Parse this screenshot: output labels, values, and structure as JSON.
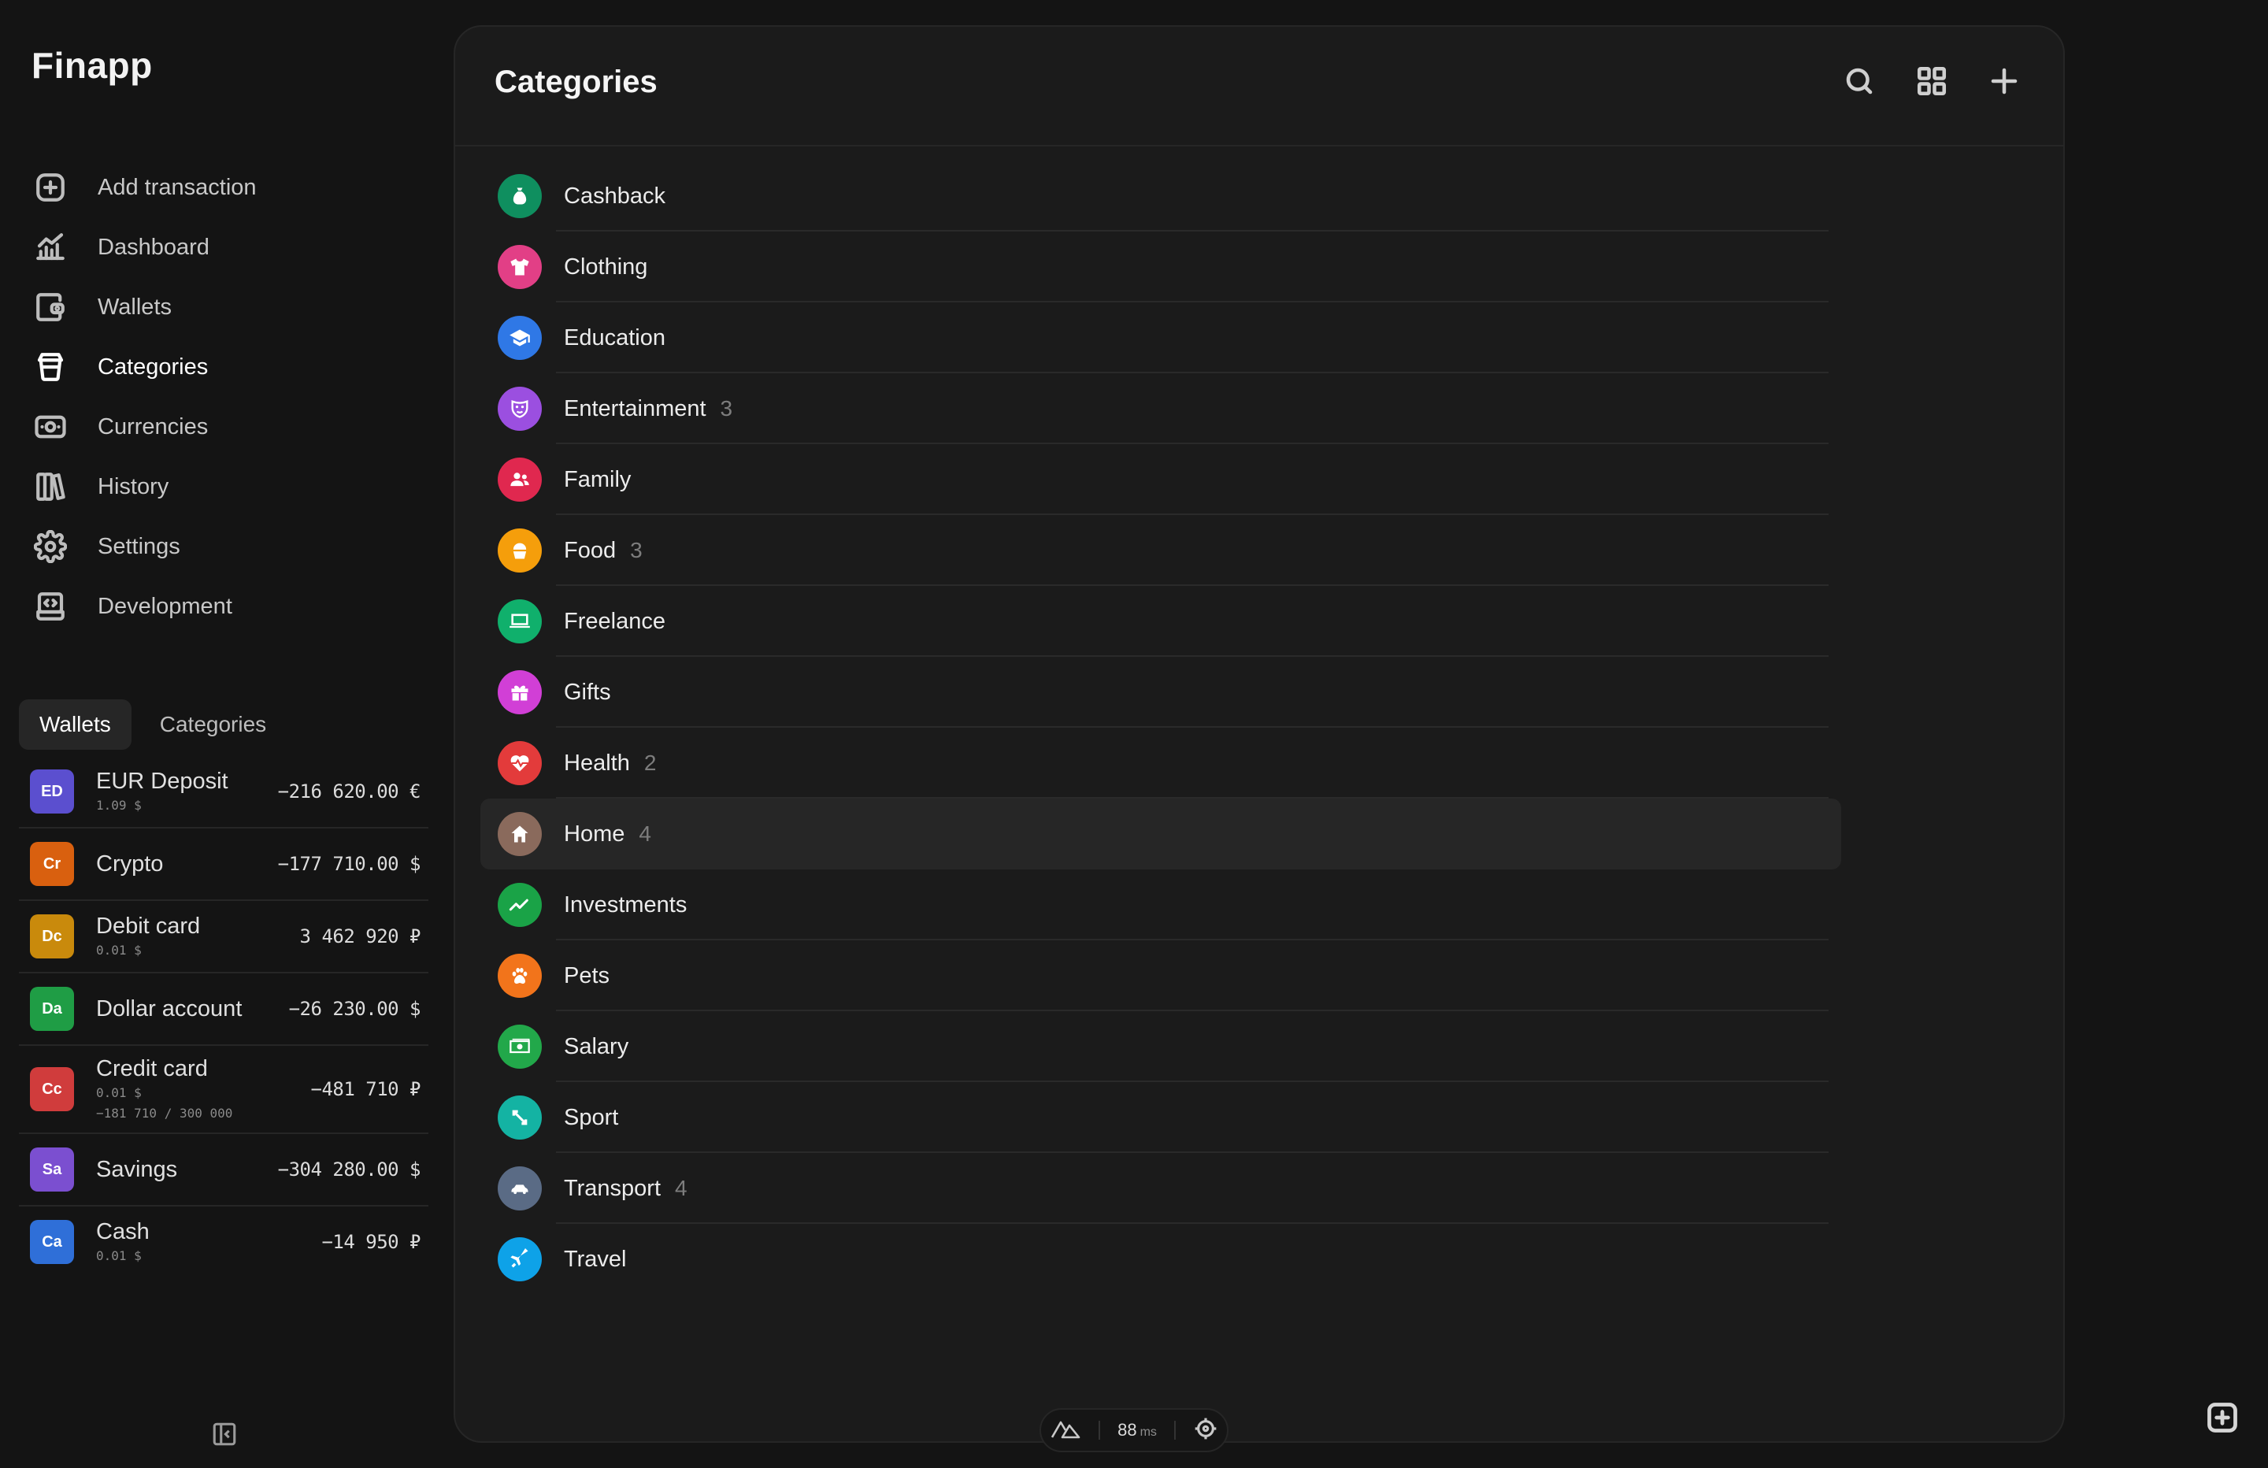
{
  "app": {
    "title": "Finapp"
  },
  "nav": {
    "items": [
      {
        "label": "Add transaction",
        "icon": "plus-square-icon"
      },
      {
        "label": "Dashboard",
        "icon": "chart-icon"
      },
      {
        "label": "Wallets",
        "icon": "wallet-icon"
      },
      {
        "label": "Categories",
        "icon": "categories-icon",
        "active": true
      },
      {
        "label": "Currencies",
        "icon": "banknote-icon"
      },
      {
        "label": "History",
        "icon": "books-icon"
      },
      {
        "label": "Settings",
        "icon": "gear-icon"
      },
      {
        "label": "Development",
        "icon": "code-icon"
      }
    ]
  },
  "sidebar_tabs": {
    "wallets": "Wallets",
    "categories": "Categories"
  },
  "wallets": [
    {
      "badge": "ED",
      "name": "EUR Deposit",
      "sub": "1.09 $",
      "sub2": "",
      "amount": "−216 620.00 €",
      "color": "#5b4fcf"
    },
    {
      "badge": "Cr",
      "name": "Crypto",
      "sub": "",
      "sub2": "",
      "amount": "−177 710.00 $",
      "color": "#d9600f"
    },
    {
      "badge": "Dc",
      "name": "Debit card",
      "sub": "0.01 $",
      "sub2": "",
      "amount": "3 462 920 ₽",
      "color": "#c98a0c"
    },
    {
      "badge": "Da",
      "name": "Dollar account",
      "sub": "",
      "sub2": "",
      "amount": "−26 230.00 $",
      "color": "#1f9d45"
    },
    {
      "badge": "Cc",
      "name": "Credit card",
      "sub": "0.01 $",
      "sub2": "−181 710 / 300 000",
      "amount": "−481 710 ₽",
      "color": "#d03c3c"
    },
    {
      "badge": "Sa",
      "name": "Savings",
      "sub": "",
      "sub2": "",
      "amount": "−304 280.00 $",
      "color": "#7b4fd0"
    },
    {
      "badge": "Ca",
      "name": "Cash",
      "sub": "0.01 $",
      "sub2": "",
      "amount": "−14 950 ₽",
      "color": "#2f6fd8"
    }
  ],
  "main": {
    "title": "Categories",
    "categories": [
      {
        "name": "Cashback",
        "count": "",
        "color": "#0f8f5f",
        "icon": "money-bag-icon"
      },
      {
        "name": "Clothing",
        "count": "",
        "color": "#e23f86",
        "icon": "tshirt-icon"
      },
      {
        "name": "Education",
        "count": "",
        "color": "#2f78e6",
        "icon": "graduation-cap-icon"
      },
      {
        "name": "Entertainment",
        "count": "3",
        "color": "#9b4fe0",
        "icon": "mask-icon"
      },
      {
        "name": "Family",
        "count": "",
        "color": "#e0284f",
        "icon": "people-icon"
      },
      {
        "name": "Food",
        "count": "3",
        "color": "#f59e0b",
        "icon": "cupcake-icon"
      },
      {
        "name": "Freelance",
        "count": "",
        "color": "#10b06c",
        "icon": "laptop-icon"
      },
      {
        "name": "Gifts",
        "count": "",
        "color": "#d13fd6",
        "icon": "gift-icon"
      },
      {
        "name": "Health",
        "count": "2",
        "color": "#e33b3b",
        "icon": "heartbeat-icon"
      },
      {
        "name": "Home",
        "count": "4",
        "color": "#8a6a5c",
        "icon": "house-icon",
        "selected": true
      },
      {
        "name": "Investments",
        "count": "",
        "color": "#1aa347",
        "icon": "trend-up-icon"
      },
      {
        "name": "Pets",
        "count": "",
        "color": "#f2741b",
        "icon": "paw-icon"
      },
      {
        "name": "Salary",
        "count": "",
        "color": "#22a84a",
        "icon": "banknote-icon"
      },
      {
        "name": "Sport",
        "count": "",
        "color": "#14b3a3",
        "icon": "dumbbell-icon"
      },
      {
        "name": "Transport",
        "count": "4",
        "color": "#5a6b85",
        "icon": "car-icon"
      },
      {
        "name": "Travel",
        "count": "",
        "color": "#0ea2e8",
        "icon": "plane-icon"
      }
    ]
  },
  "devtools": {
    "time": "88",
    "unit": "ms"
  }
}
